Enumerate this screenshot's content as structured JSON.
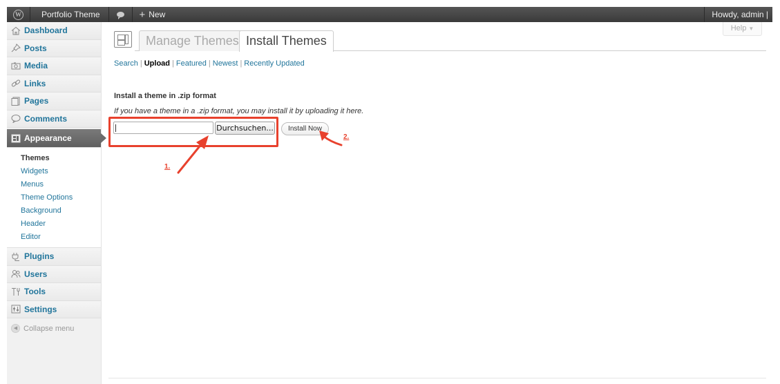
{
  "admin_bar": {
    "site_name": "Portfolio Theme",
    "new_label": "New",
    "howdy": "Howdy, admin |"
  },
  "sidebar": {
    "items_top": [
      {
        "label": "Dashboard",
        "icon": "house-icon"
      },
      {
        "label": "Posts",
        "icon": "pushpin-icon"
      },
      {
        "label": "Media",
        "icon": "camera-icon"
      },
      {
        "label": "Links",
        "icon": "chain-link-icon"
      },
      {
        "label": "Pages",
        "icon": "pages-icon"
      },
      {
        "label": "Comments",
        "icon": "speech-bubble-icon"
      }
    ],
    "active_section": {
      "label": "Appearance",
      "icon": "appearance-icon"
    },
    "submenu": [
      "Themes",
      "Widgets",
      "Menus",
      "Theme Options",
      "Background",
      "Header",
      "Editor"
    ],
    "submenu_current": "Themes",
    "items_bottom": [
      {
        "label": "Plugins",
        "icon": "plug-icon"
      },
      {
        "label": "Users",
        "icon": "users-icon"
      },
      {
        "label": "Tools",
        "icon": "tools-icon"
      },
      {
        "label": "Settings",
        "icon": "settings-icon"
      }
    ],
    "collapse_label": "Collapse menu"
  },
  "help_label": "Help",
  "tabs": {
    "manage": "Manage Themes",
    "install": "Install Themes",
    "active": "Install Themes"
  },
  "subnav": {
    "links": [
      "Search",
      "Upload",
      "Featured",
      "Newest",
      "Recently Updated"
    ],
    "current": "Upload",
    "separator": "|"
  },
  "upload": {
    "heading": "Install a theme in .zip format",
    "description": "If you have a theme in a .zip format, you may install it by uploading it here.",
    "file_value": "",
    "browse_label": "Durchsuchen...",
    "install_label": "Install Now"
  },
  "annotations": {
    "label_1": "1.",
    "label_2": "2.",
    "color": "#e8412d"
  },
  "colors": {
    "link": "#21759b",
    "admin_bar": "#464646",
    "sidebar_active": "#6b6b6b"
  }
}
